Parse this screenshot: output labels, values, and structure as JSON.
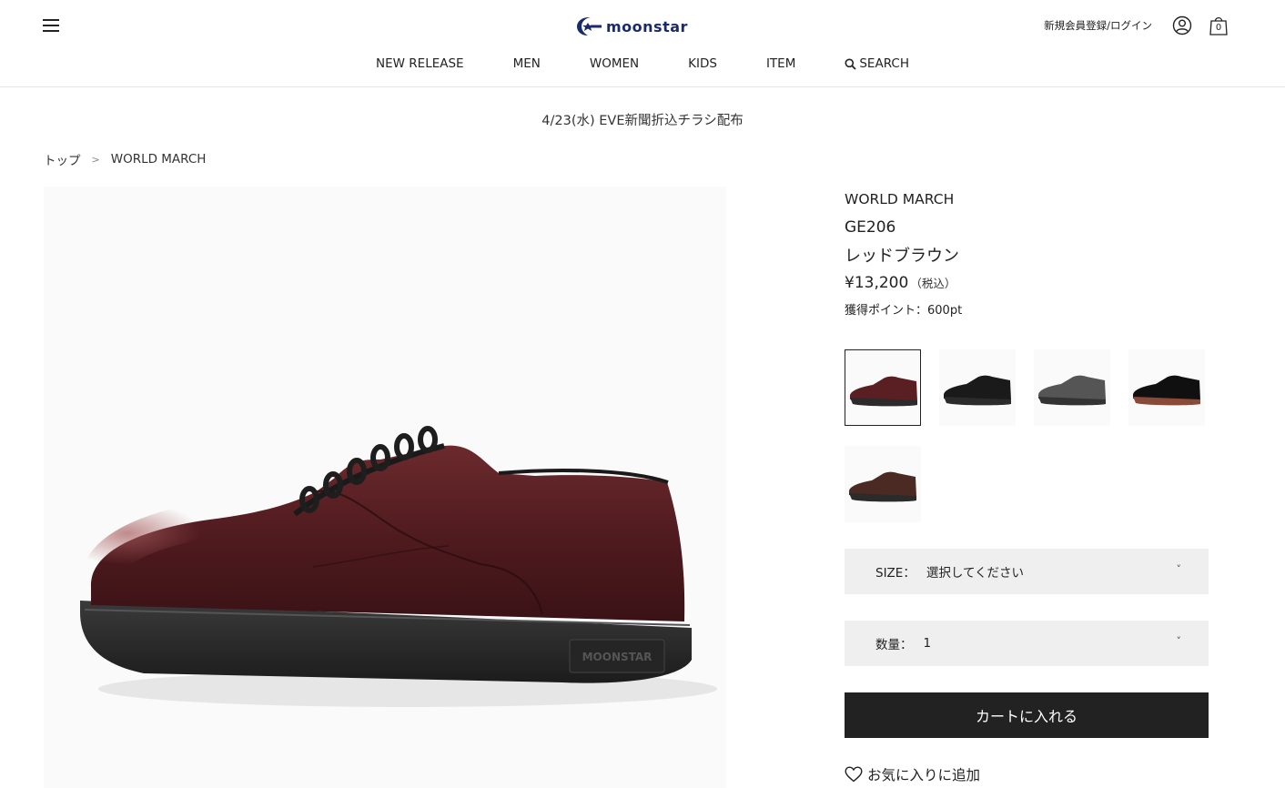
{
  "header": {
    "logo_text": "moonstar",
    "login_label": "新規会員登録/ログイン",
    "cart_count": "0"
  },
  "nav": {
    "items": [
      "NEW RELEASE",
      "MEN",
      "WOMEN",
      "KIDS",
      "ITEM"
    ],
    "search_label": "SEARCH"
  },
  "announcement": "4/23(水) EVE新聞折込チラシ配布",
  "breadcrumb": {
    "home": "トップ",
    "separator": ">",
    "current": "WORLD MARCH"
  },
  "product": {
    "brand": "WORLD MARCH",
    "model": "GE206",
    "color_name": "レッドブラウン",
    "price": "¥13,200",
    "tax_note": "（税込）",
    "points": "獲得ポイント：600pt",
    "sole_logo": "MOONSTAR"
  },
  "swatches": [
    {
      "color": "#5a1f22",
      "sole": "#2b2b2b",
      "selected": true
    },
    {
      "color": "#1a1a1a",
      "sole": "#2b2b2b",
      "selected": false
    },
    {
      "color": "#555555",
      "sole": "#333333",
      "selected": false
    },
    {
      "color": "#101010",
      "sole": "#8a4a3a",
      "selected": false
    },
    {
      "color": "#4a2a22",
      "sole": "#2b2b2b",
      "selected": false
    }
  ],
  "size_select": {
    "label": "SIZE：",
    "value": "選択してください",
    "caret": "˅"
  },
  "qty_select": {
    "label": "数量：",
    "value": "1",
    "caret": "˅"
  },
  "cart_button_label": "カートに入れる",
  "favorite_label": "お気に入りに追加",
  "colors": {
    "accent": "#222222",
    "select_bg": "#efefef",
    "logo": "#1b2a6b"
  }
}
